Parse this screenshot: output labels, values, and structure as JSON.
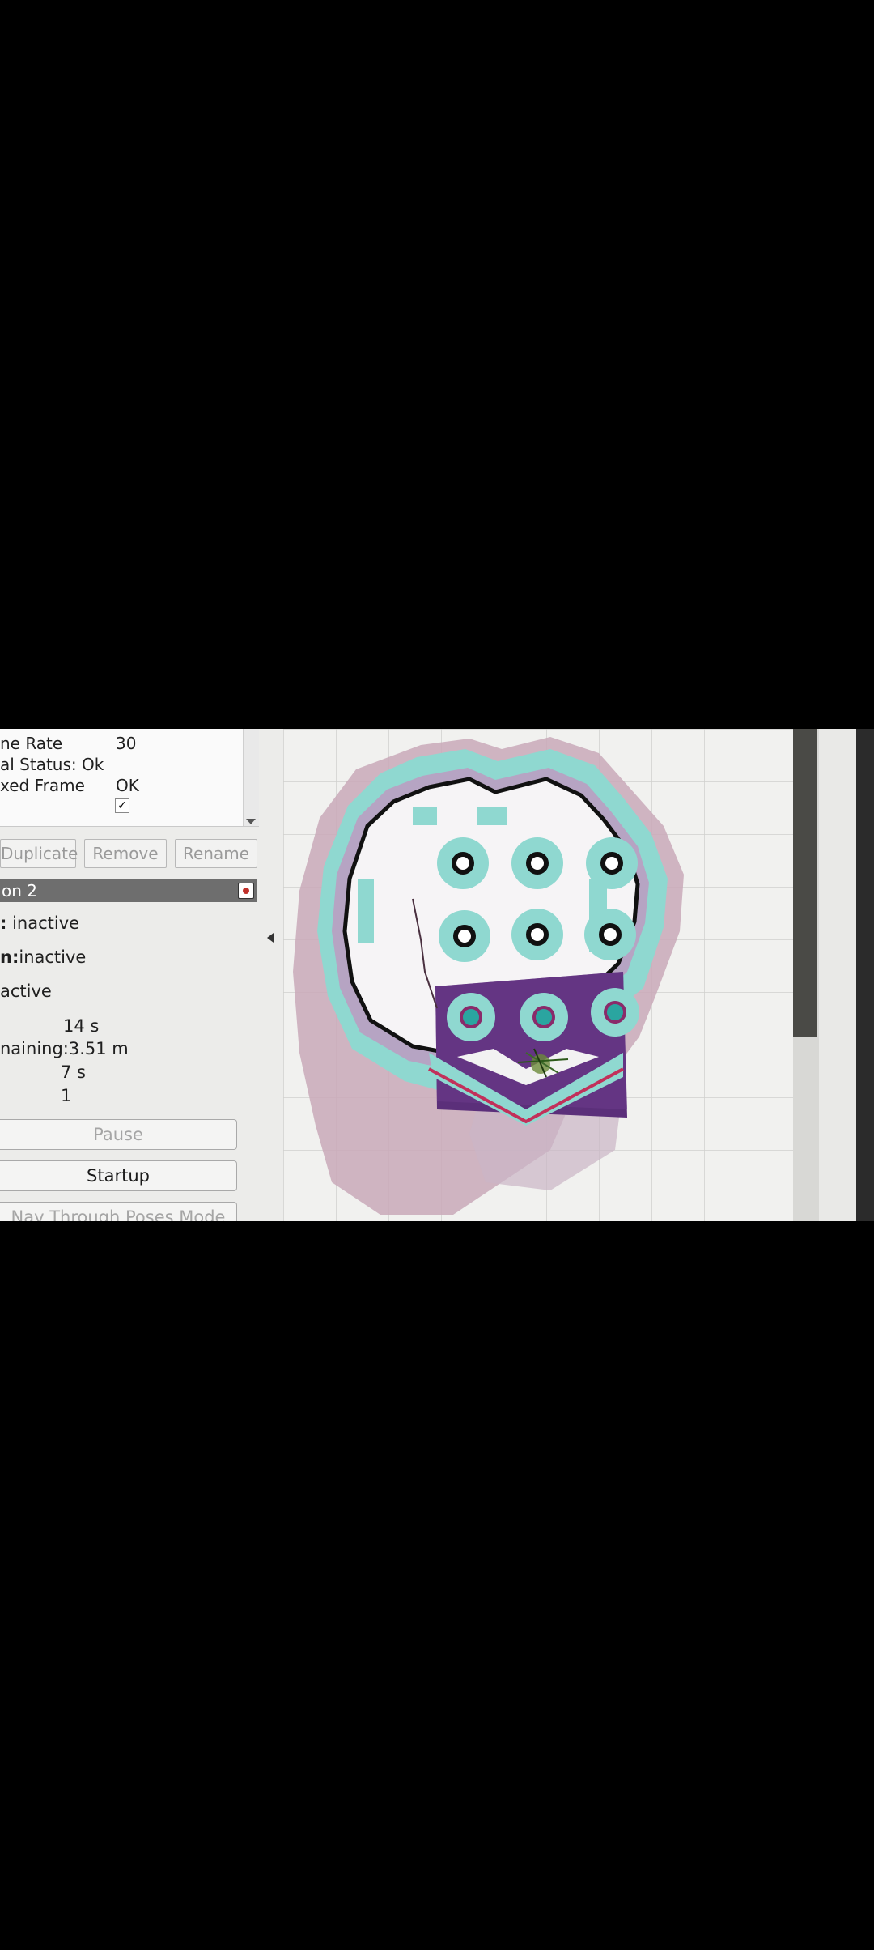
{
  "properties": {
    "rows": [
      {
        "label": "ne Rate",
        "value": "30"
      },
      {
        "label": "al Status: Ok",
        "value": ""
      },
      {
        "label": "xed Frame",
        "value": "OK"
      }
    ],
    "checkbox": "✓"
  },
  "toolbar": {
    "duplicate_label": "Duplicate",
    "remove_label": "Remove",
    "rename_label": "Rename"
  },
  "panel": {
    "title": "on 2"
  },
  "status": {
    "line1_key": ":",
    "line1_value": "inactive",
    "line2_key": "n:",
    "line2_value": "inactive",
    "line3": "active",
    "time": "14 s",
    "distance_label": "naining:",
    "distance_value": "3.51 m",
    "eta": "7 s",
    "recoveries": "1"
  },
  "buttons": {
    "pause_label": "Pause",
    "startup_label": "Startup",
    "nav_mode_label": "Nav Through Poses Mode"
  }
}
